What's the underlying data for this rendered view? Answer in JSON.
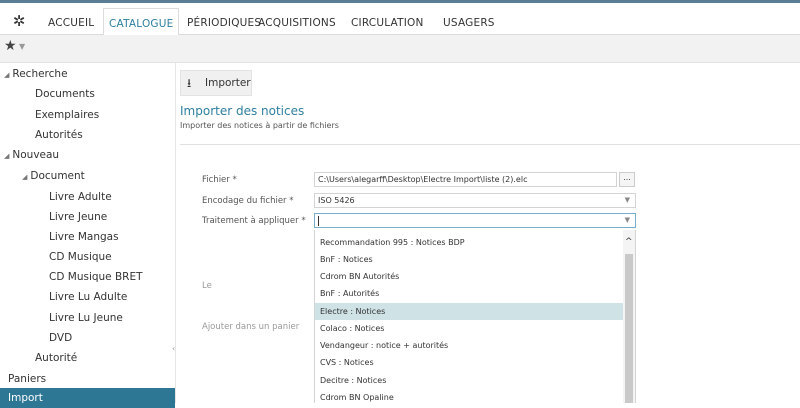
{
  "nav": {
    "tabs": [
      "ACCUEIL",
      "CATALOGUE",
      "PÉRIODIQUES",
      "ACQUISITIONS",
      "CIRCULATION",
      "USAGERS"
    ],
    "active_tab": "CATALOGUE"
  },
  "toolbar": {
    "favorites_icon": "star-icon"
  },
  "sidebar": {
    "recherche": "Recherche",
    "documents": "Documents",
    "exemplaires": "Exemplaires",
    "autorites": "Autorités",
    "nouveau": "Nouveau",
    "document": "Document",
    "livre_adulte": "Livre Adulte",
    "livre_jeune": "Livre Jeune",
    "livre_mangas": "Livre Mangas",
    "cd_musique": "CD Musique",
    "cd_musique_bret": "CD Musique BRET",
    "livre_lu_adulte": "Livre Lu Adulte",
    "livre_lu_jeune": "Livre Lu Jeune",
    "dvd": "DVD",
    "autorite": "Autorité",
    "paniers": "Paniers",
    "import": "Import"
  },
  "main": {
    "import_button": "Importer",
    "title": "Importer des notices",
    "subtitle": "Importer des notices à partir de fichiers",
    "fichier_label": "Fichier *",
    "fichier_value": "C:\\Users\\alegarff\\Desktop\\Electre Import\\liste (2).elc",
    "browse_label": "...",
    "encodage_label": "Encodage du fichier *",
    "encodage_value": "ISO 5426",
    "traitement_label": "Traitement à appliquer *",
    "traitement_value": "",
    "le_label": "Le",
    "panier_label": "Ajouter dans un panier"
  },
  "dropdown": {
    "options": [
      "Recommandation 995 : Notices BDP",
      "BnF : Notices",
      "Cdrom BN Autorités",
      "BnF : Autorités",
      "Electre : Notices",
      "Colaco : Notices",
      "Vendangeur : notice + autorités",
      "CVS : Notices",
      "Decitre : Notices",
      "Cdrom BN Opaline"
    ],
    "highlighted": "Electre : Notices"
  }
}
